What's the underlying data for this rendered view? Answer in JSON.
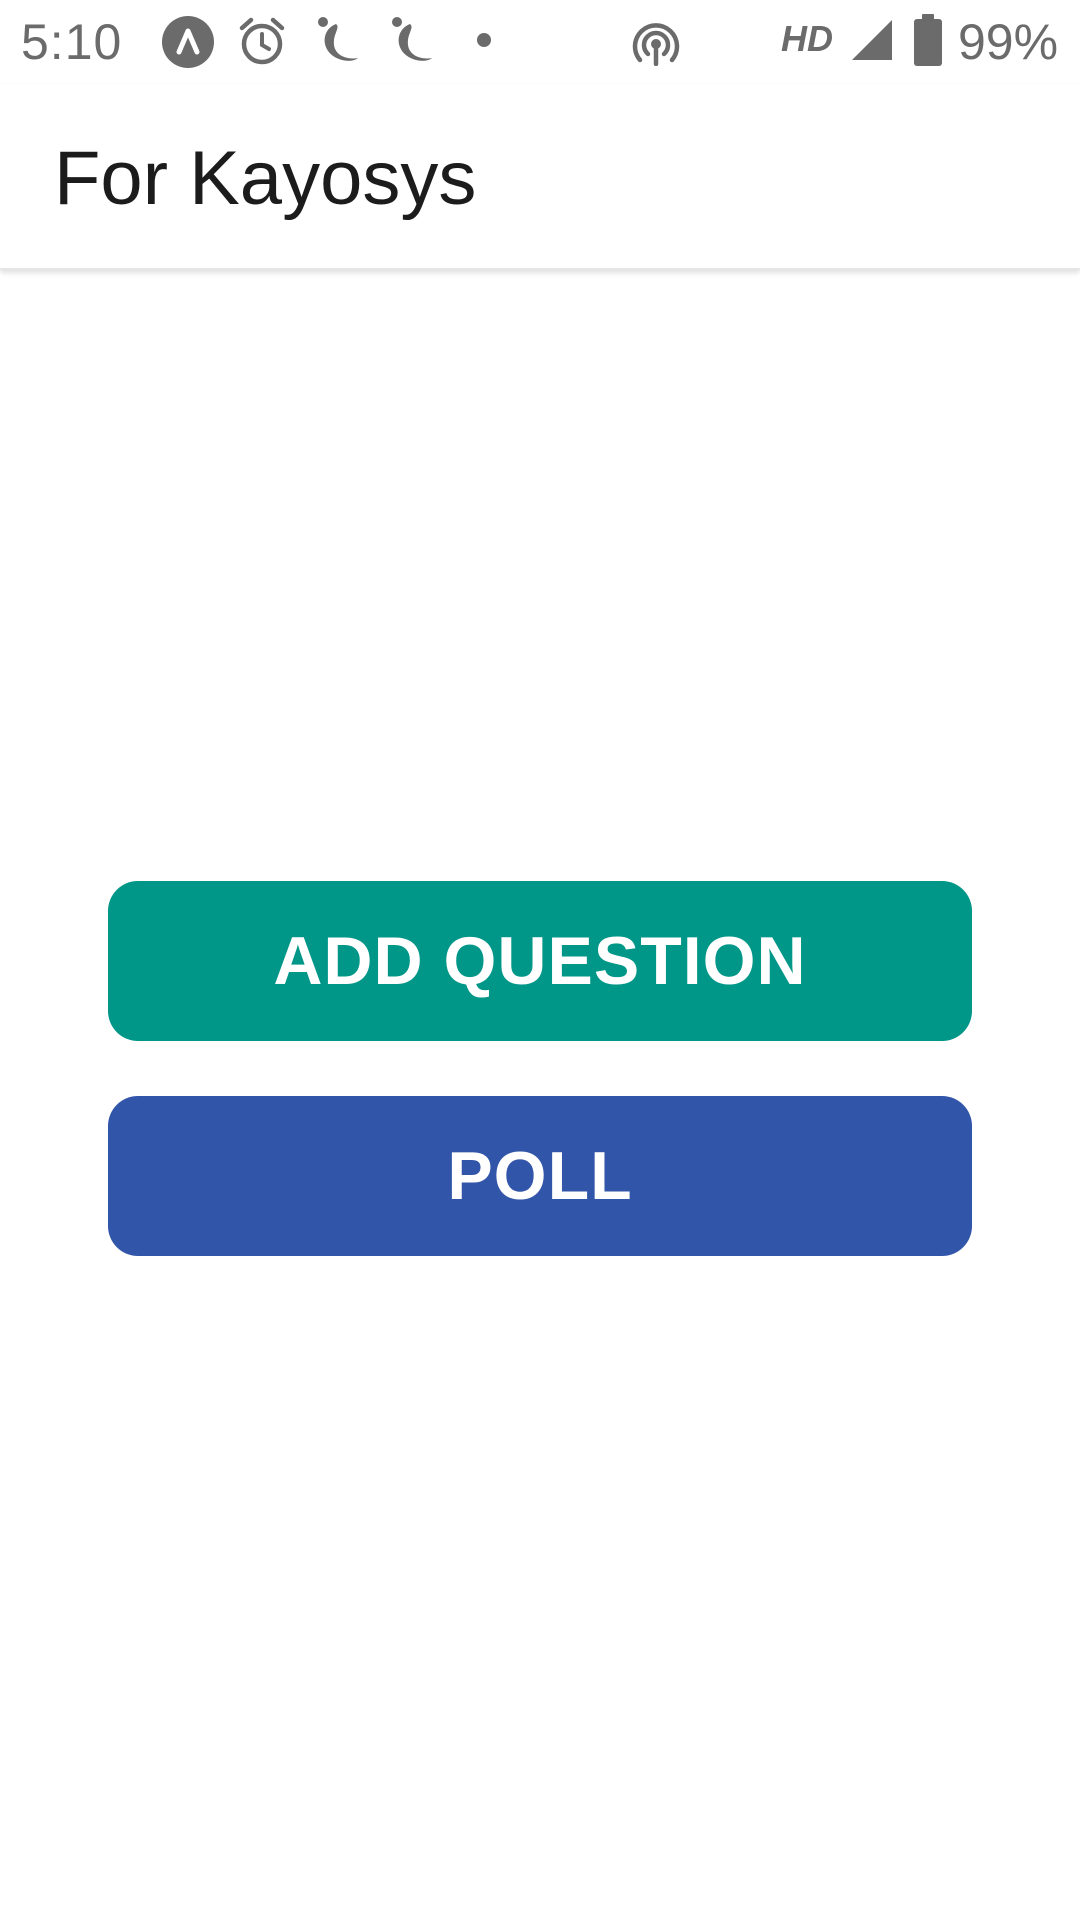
{
  "status_bar": {
    "time": "5:10",
    "network_label": "HD",
    "battery_percent": "99%",
    "icons": [
      "app-notification-icon",
      "alarm-icon",
      "app-logo-icon",
      "app-logo-icon",
      "notification-dot-icon",
      "hotspot-icon",
      "cell-signal-icon",
      "battery-icon"
    ]
  },
  "app_bar": {
    "title": "For Kayosys"
  },
  "actions": {
    "add_question_label": "ADD QUESTION",
    "poll_label": "POLL"
  },
  "colors": {
    "add_question_bg": "#009688",
    "poll_bg": "#3155a8",
    "status_icon": "#6b6b6b",
    "title_text": "#1c1c1c"
  }
}
